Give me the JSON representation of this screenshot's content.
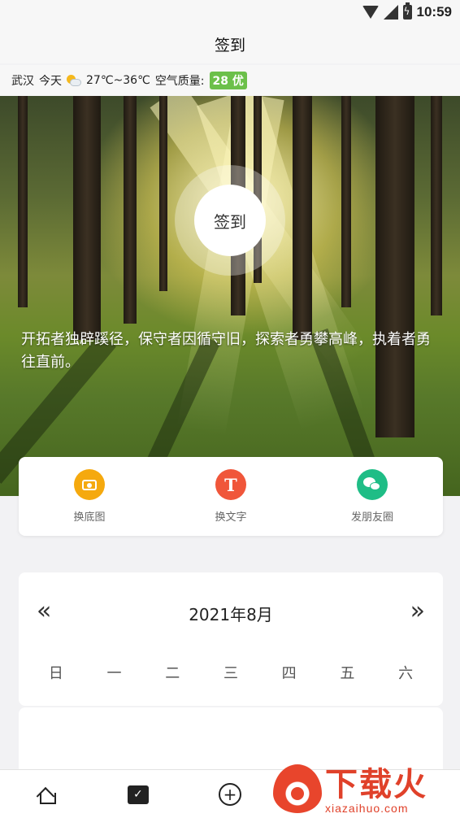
{
  "status_bar": {
    "time": "10:59"
  },
  "header": {
    "title": "签到"
  },
  "weather": {
    "city": "武汉",
    "day": "今天",
    "icon": "partly-cloudy-icon",
    "temperature": "27℃~36℃",
    "aqi_label": "空气质量:",
    "aqi_value": "28 优"
  },
  "hero": {
    "sign_in_label": "签到",
    "quote": "开拓者独辟蹊径，保守者因循守旧，探索者勇攀高峰，执着者勇往直前。"
  },
  "actions": [
    {
      "label": "换底图",
      "icon": "camera-icon",
      "color": "#f5a90e"
    },
    {
      "label": "换文字",
      "icon": "text-icon",
      "color": "#f0563a"
    },
    {
      "label": "发朋友圈",
      "icon": "wechat-icon",
      "color": "#1fbd86"
    }
  ],
  "calendar": {
    "prev": "«",
    "next": "»",
    "month_title": "2021年8月",
    "weekdays": [
      "日",
      "一",
      "二",
      "三",
      "四",
      "五",
      "六"
    ]
  },
  "bottom_nav": [
    "home-icon",
    "checkin-calendar-icon",
    "add-icon"
  ],
  "watermark": {
    "title": "下载火",
    "url": "xiazaihuo.com"
  }
}
